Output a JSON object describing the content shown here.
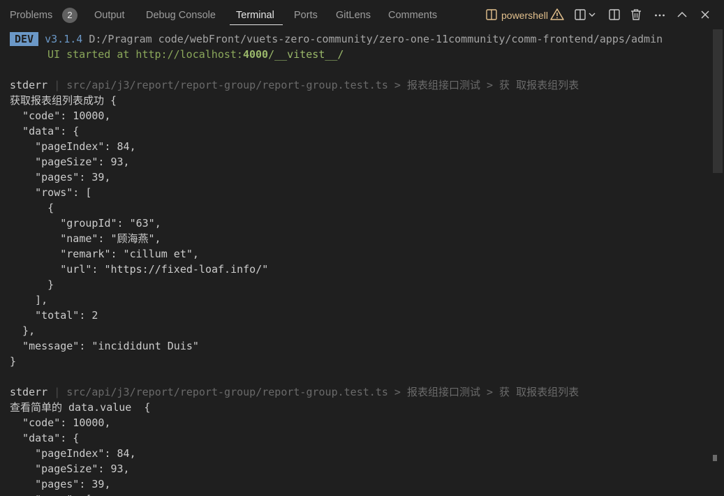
{
  "panel": {
    "tabs": [
      {
        "label": "Problems"
      },
      {
        "label": "Output"
      },
      {
        "label": "Debug Console"
      },
      {
        "label": "Terminal"
      },
      {
        "label": "Ports"
      },
      {
        "label": "GitLens"
      },
      {
        "label": "Comments"
      }
    ],
    "active_tab": "Terminal",
    "problems_badge": "2",
    "terminal_name": "powershell",
    "accent_color": "#e7e7e7",
    "warning_color": "#e2c08d",
    "icons": [
      "terminal-icon",
      "warning-icon",
      "split-terminal-icon",
      "chevron-down-icon",
      "layout-panel-icon",
      "trash-icon",
      "more-icon",
      "maximize-icon",
      "close-icon"
    ]
  },
  "terminal": {
    "header": {
      "badge": "DEV",
      "version": "v3.1.4",
      "path": "D:/Pragram code/webFront/vuets-zero-community/zero-one-11community/comm-frontend/apps/admin",
      "started_text": "UI started at http://localhost:",
      "port": "4000",
      "url_suffix": "/__vitest__/"
    },
    "blocks": [
      {
        "stderr_label": "stderr",
        "source": "src/api/j3/report/report-group/report-group.test.ts > 报表组接口测试 > 获 取报表组列表",
        "lines": [
          "获取报表组列表成功 {",
          "  \"code\": 10000,",
          "  \"data\": {",
          "    \"pageIndex\": 84,",
          "    \"pageSize\": 93,",
          "    \"pages\": 39,",
          "    \"rows\": [",
          "      {",
          "        \"groupId\": \"63\",",
          "        \"name\": \"顾海燕\",",
          "        \"remark\": \"cillum et\",",
          "        \"url\": \"https://fixed-loaf.info/\"",
          "      }",
          "    ],",
          "    \"total\": 2",
          "  },",
          "  \"message\": \"incididunt Duis\"",
          "}"
        ]
      },
      {
        "stderr_label": "stderr",
        "source": "src/api/j3/report/report-group/report-group.test.ts > 报表组接口测试 > 获 取报表组列表",
        "lines": [
          "查看简单的 data.value  {",
          "  \"code\": 10000,",
          "  \"data\": {",
          "    \"pageIndex\": 84,",
          "    \"pageSize\": 93,",
          "    \"pages\": 39,",
          "    \"rows\": ["
        ]
      }
    ]
  }
}
